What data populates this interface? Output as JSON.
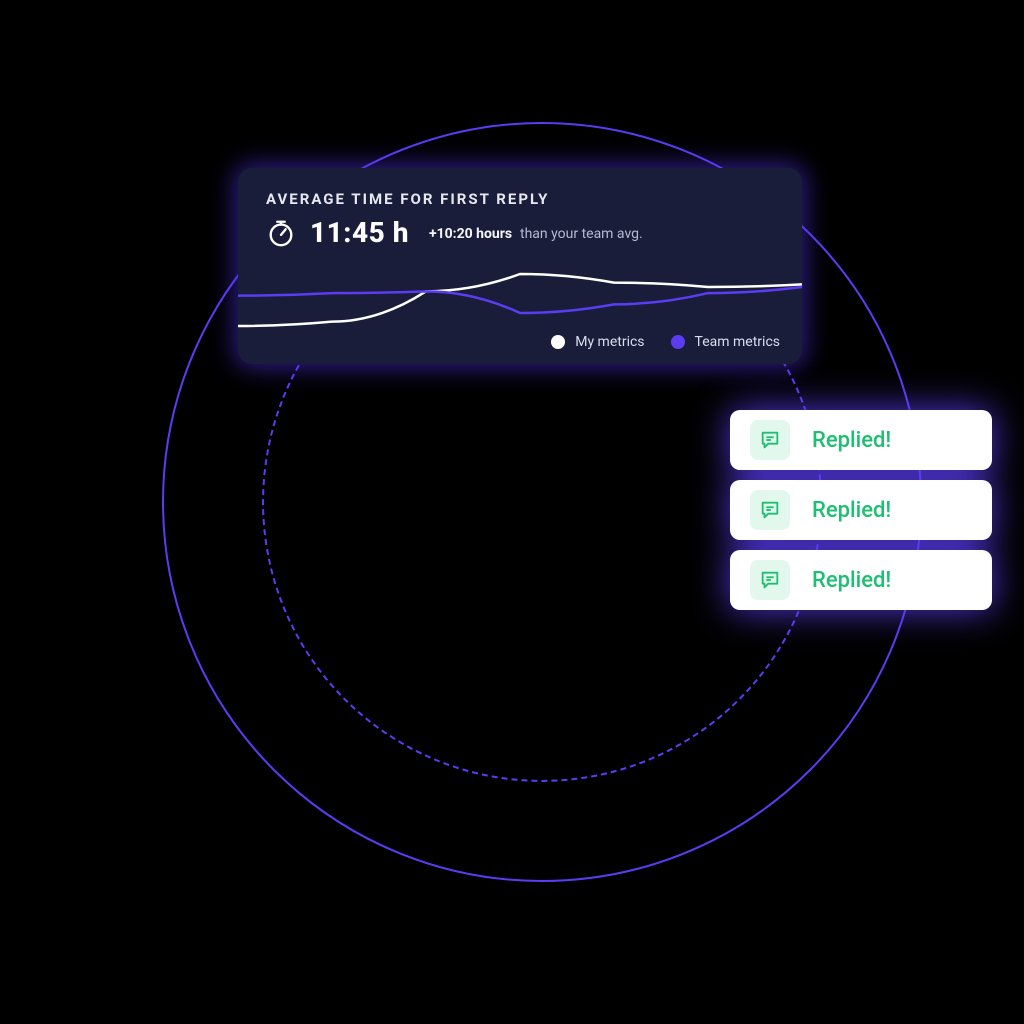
{
  "colors": {
    "accent": "#5B3CF3",
    "card_bg": "#191D3A",
    "success": "#1EBF73",
    "my_series": "#FFFFFF",
    "team_series": "#5B3CF3"
  },
  "card": {
    "title": "AVERAGE TIME FOR FIRST REPLY",
    "icon": "stopwatch-icon",
    "value": "11:45 h",
    "delta": "+10:20 hours",
    "suffix": "than your team avg."
  },
  "legend": {
    "items": [
      {
        "label": "My metrics",
        "dot_color": "#FFFFFF"
      },
      {
        "label": "Team metrics",
        "dot_color": "#5B3CF3"
      }
    ]
  },
  "chart_data": {
    "type": "line",
    "title": "Average time for first reply",
    "xlabel": "",
    "ylabel": "",
    "series": [
      {
        "name": "My metrics",
        "values": [
          8.0,
          8.5,
          12.0,
          14.0,
          13.0,
          12.5,
          12.8
        ]
      },
      {
        "name": "Team metrics",
        "values": [
          11.5,
          11.8,
          12.0,
          9.5,
          10.5,
          11.8,
          12.5
        ]
      }
    ]
  },
  "pills": [
    {
      "icon": "chat-reply-icon",
      "label": "Replied!"
    },
    {
      "icon": "chat-reply-icon",
      "label": "Replied!"
    },
    {
      "icon": "chat-reply-icon",
      "label": "Replied!"
    }
  ]
}
